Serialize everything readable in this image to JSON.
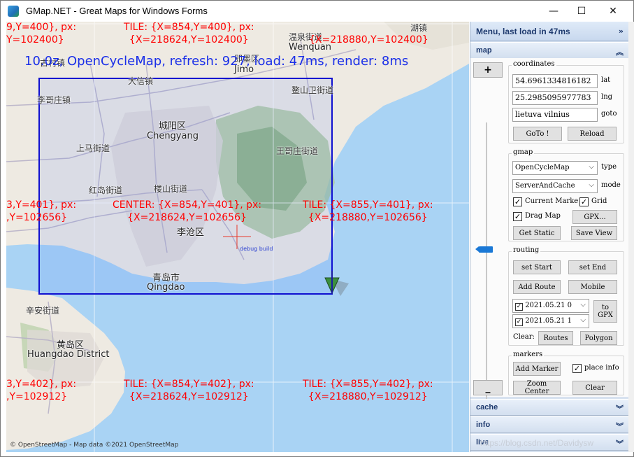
{
  "window": {
    "title": "GMap.NET - Great Maps for Windows Forms",
    "min_glyph": "—",
    "max_glyph": "☐",
    "close_glyph": "✕"
  },
  "map": {
    "status": "10.0z, OpenCycleMap, refresh: 927, load: 47ms, render: 8ms",
    "attribution": "© OpenStreetMap - Map data ©2021 OpenStreetMap",
    "debug_label": "debug build",
    "tiles": [
      {
        "line1": "9,Y=400}, px:",
        "line2": "Y=102400}"
      },
      {
        "line1": "TILE: {X=854,Y=400}, px:",
        "line2": "{X=218624,Y=102400}"
      },
      {
        "line1": "",
        "line2": "{X=218880,Y=102400}"
      },
      {
        "line1": "3,Y=401}, px:",
        "line2": ",Y=102656}"
      },
      {
        "line1": "CENTER: {X=854,Y=401}, px:",
        "line2": "{X=218624,Y=102656}"
      },
      {
        "line1": "TILE: {X=855,Y=401}, px:",
        "line2": "{X=218880,Y=102656}"
      },
      {
        "line1": "3,Y=402}, px:",
        "line2": ",Y=102912}"
      },
      {
        "line1": "TILE: {X=854,Y=402}, px:",
        "line2": "{X=218624,Y=102912}"
      },
      {
        "line1": "TILE: {X=855,Y=402}, px:",
        "line2": "{X=218880,Y=102912}"
      }
    ],
    "places": {
      "p1": "温泉街道",
      "p2": "Wenquan",
      "p3": "即墨区",
      "p4": "Jimo",
      "p5": "大信镇",
      "p6": "李哥庄镇",
      "p7": "鳌山卫街道",
      "p8": "城阳区",
      "p9": "Chengyang",
      "p10": "上马街道",
      "p11": "王哥庄街道",
      "p12": "红岛街道",
      "p13": "楼山街道",
      "p14": "李沧区",
      "p15": "青岛市",
      "p16": "Qingdao",
      "p17": "辛安街道",
      "p18": "黄岛区",
      "p19": "Huangdao District",
      "p20": "湖镇",
      "p21": "古村镇"
    }
  },
  "panel": {
    "header": "Menu, last load in 47ms",
    "map_section": "map",
    "zoom_in": "+",
    "zoom_out": "_",
    "zoom_level_fraction": 0.56,
    "coordinates": {
      "title": "coordinates",
      "lat_value": "54.6961334816182",
      "lat_label": "lat",
      "lng_value": "25.2985095977783",
      "lng_label": "lng",
      "goto_value": "lietuva vilnius",
      "goto_label": "goto",
      "goto_button": "GoTo !",
      "reload_button": "Reload"
    },
    "gmap": {
      "title": "gmap",
      "type_value": "OpenCycleMap",
      "type_label": "type",
      "mode_value": "ServerAndCache",
      "mode_label": "mode",
      "current_marker": "Current Marke",
      "grid": "Grid",
      "drag_map": "Drag Map",
      "gpx_button": "GPX...",
      "get_static": "Get Static",
      "save_view": "Save View"
    },
    "routing": {
      "title": "routing",
      "set_start": "set Start",
      "set_end": "set End",
      "add_route": "Add Route",
      "mobile": "Mobile",
      "date1": "2021.05.21 0",
      "date2": "2021.05.21 1",
      "to_gpx": "to GPX",
      "clear_label": "Clear:",
      "routes": "Routes",
      "polygon": "Polygon"
    },
    "markers": {
      "title": "markers",
      "add_marker": "Add Marker",
      "place_info": "place info",
      "zoom_center": "Zoom Center",
      "clear": "Clear"
    },
    "sections": {
      "cache": "cache",
      "info": "info",
      "live": "live"
    },
    "watermark": "https://blog.csdn.net/Davidysw"
  },
  "colors": {
    "tile_text": "#ff0000",
    "status_text": "#1a2fe8",
    "selection_rect": "#1010d0",
    "panel_header_text": "#1e3a6e",
    "zoom_thumb": "#1a78d6"
  }
}
